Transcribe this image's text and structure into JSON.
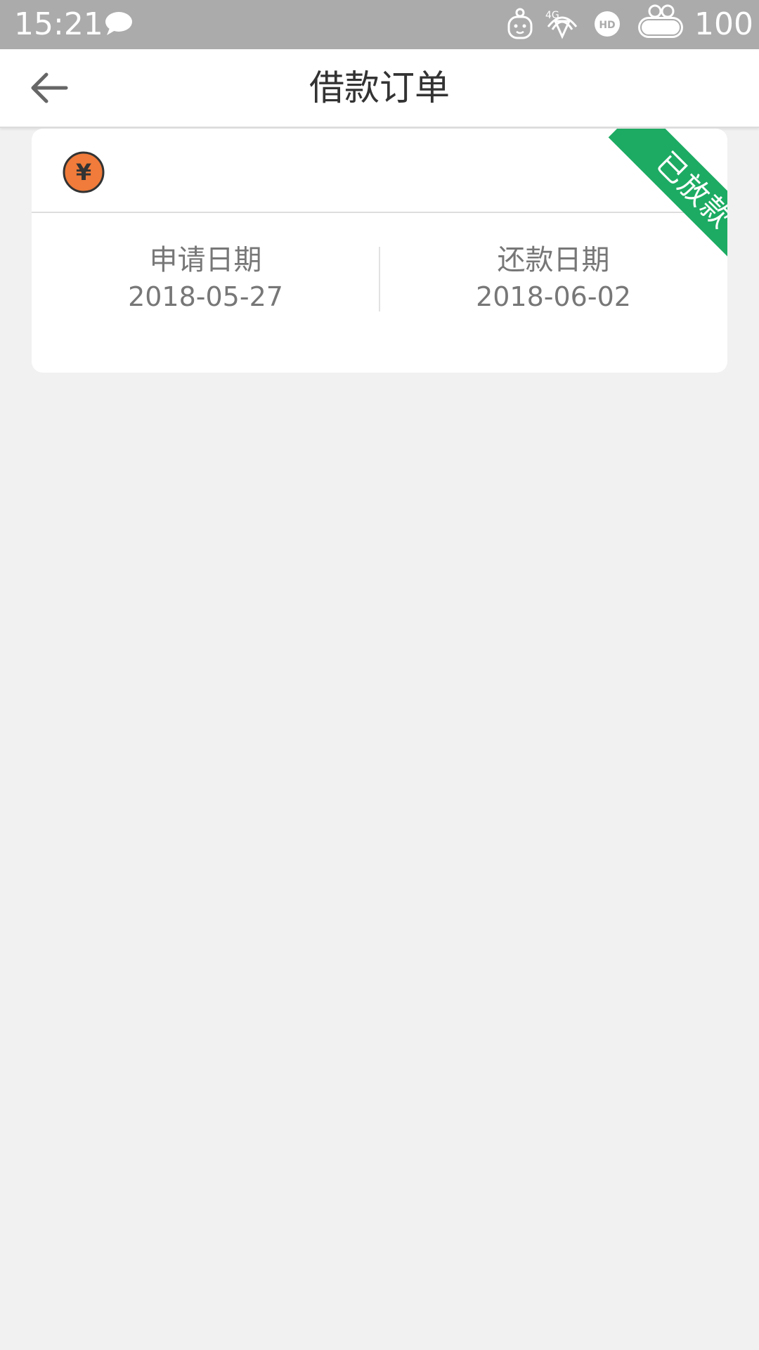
{
  "status_bar": {
    "time": "15:21",
    "battery_level": "100",
    "icons": [
      "message-icon",
      "mascot-icon",
      "signal-4g-icon",
      "hd-icon",
      "battery-icon"
    ],
    "signal_label": "4G",
    "hd_label": "HD",
    "background_color": "#ababab"
  },
  "header": {
    "title": "借款订单",
    "back_icon": "arrow-left-icon"
  },
  "order_card": {
    "status_badge": "已放款",
    "status_color": "#1dab63",
    "currency_icon": "yuan-coin-icon",
    "currency_symbol": "¥",
    "currency_color": "#f07b3a",
    "apply_date_label": "申请日期",
    "apply_date_value": "2018-05-27",
    "repay_date_label": "还款日期",
    "repay_date_value": "2018-06-02"
  }
}
